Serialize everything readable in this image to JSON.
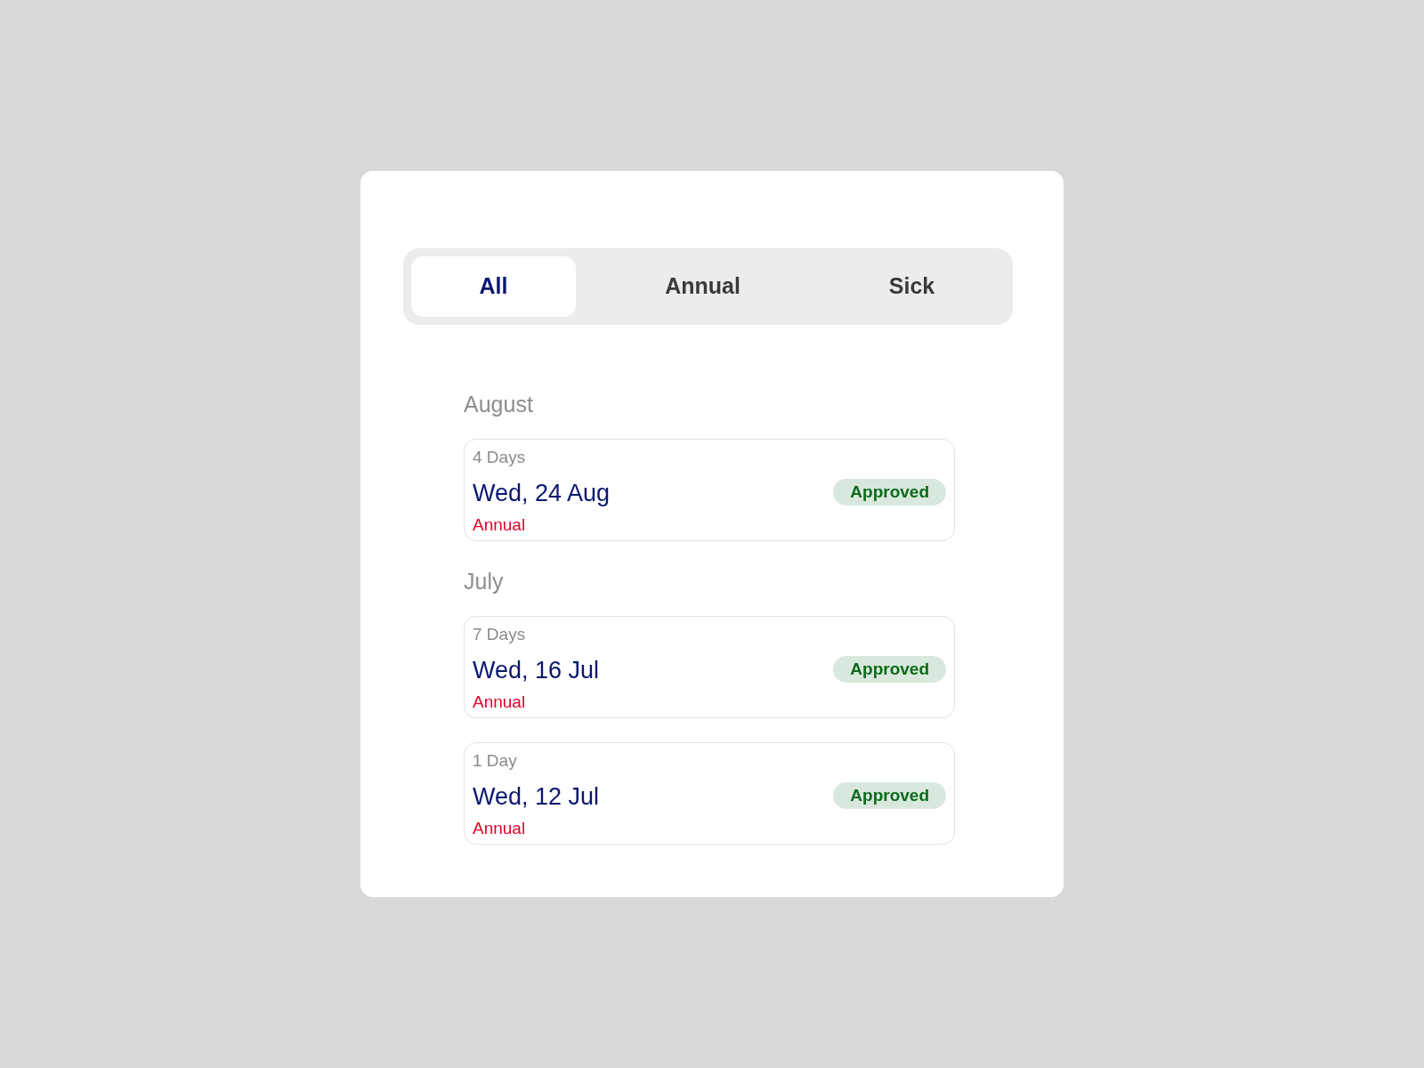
{
  "tabs": [
    {
      "label": "All",
      "selected": true
    },
    {
      "label": "Annual",
      "selected": false
    },
    {
      "label": "Sick",
      "selected": false
    }
  ],
  "groups": [
    {
      "month": "August",
      "entries": [
        {
          "duration": "4 Days",
          "date": "Wed, 24 Aug",
          "leave_type": "Annual",
          "status": "Approved"
        }
      ]
    },
    {
      "month": "July",
      "entries": [
        {
          "duration": "7 Days",
          "date": "Wed, 16 Jul",
          "leave_type": "Annual",
          "status": "Approved"
        },
        {
          "duration": "1 Day",
          "date": "Wed, 12 Jul",
          "leave_type": "Annual",
          "status": "Approved"
        }
      ]
    }
  ]
}
